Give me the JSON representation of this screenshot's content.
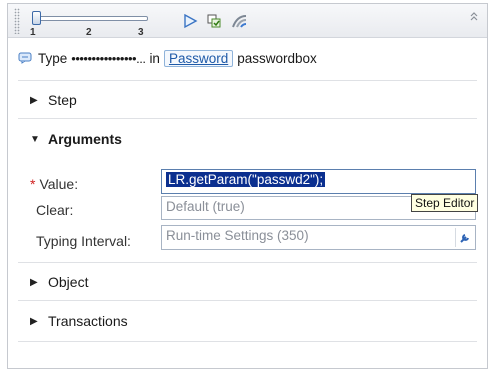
{
  "toolbar": {
    "slider": {
      "ticks": [
        "1",
        "2",
        "3"
      ],
      "value": 1
    },
    "icons": [
      "play-icon",
      "step-list-icon",
      "highlight-icon",
      "collapse-chevron-icon"
    ]
  },
  "step": {
    "verb": "Type",
    "masked_value": "••••••••••••••••...",
    "connector": "in",
    "object_link": "Password",
    "object_type": "passwordbox"
  },
  "sections": {
    "step": "Step",
    "arguments": "Arguments",
    "object": "Object",
    "transactions": "Transactions"
  },
  "arguments": {
    "value": {
      "required_mark": "*",
      "label": "Value:",
      "text": "LR.getParam(\"passwd2\");"
    },
    "clear": {
      "label": "Clear:",
      "placeholder": "Default (true)"
    },
    "typing_interval": {
      "label": "Typing Interval:",
      "placeholder": "Run-time Settings (350)"
    }
  },
  "tooltip": "Step Editor",
  "colors": {
    "selection": "#0b2f8f",
    "link": "#1f5aa8",
    "required": "#d02020",
    "tooltip_bg": "#ffffe1"
  }
}
